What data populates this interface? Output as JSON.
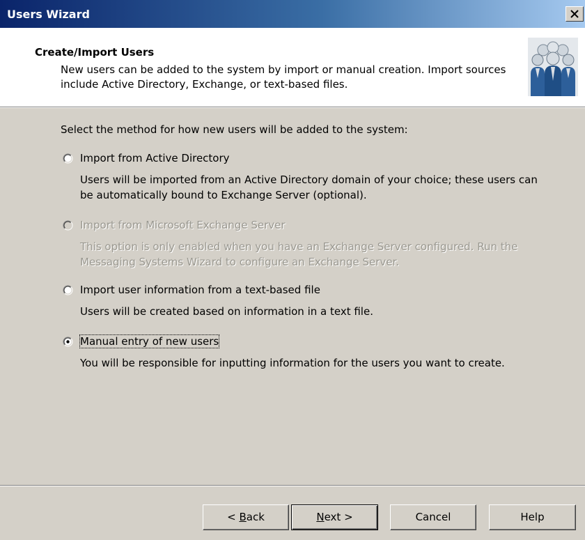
{
  "window": {
    "title": "Users Wizard"
  },
  "header": {
    "title": "Create/Import Users",
    "description": "New users can be added to the system by import or manual creation.  Import sources include Active Directory, Exchange, or text-based files.",
    "icon": "users-group-icon"
  },
  "body": {
    "prompt": "Select the method for how new users will be added to the system:",
    "options": [
      {
        "label": "Import from Active Directory",
        "description": "Users will be imported from an Active Directory domain of your choice; these users can be automatically bound to Exchange Server (optional).",
        "enabled": true,
        "selected": false
      },
      {
        "label": "Import from Microsoft Exchange Server",
        "description": "This option is only enabled when you have an Exchange Server configured.  Run the Messaging Systems Wizard to configure an Exchange Server.",
        "enabled": false,
        "selected": false
      },
      {
        "label": "Import user information from a text-based file",
        "description": "Users will be created based on information in a text file.",
        "enabled": true,
        "selected": false
      },
      {
        "label": "Manual entry of new users",
        "description": "You will be responsible for inputting information for the users you want to create.",
        "enabled": true,
        "selected": true
      }
    ]
  },
  "footer": {
    "back_label_pre": "< ",
    "back_label_key": "B",
    "back_label_post": "ack",
    "next_label_key": "N",
    "next_label_post": "ext >",
    "cancel_label": "Cancel",
    "help_label": "Help"
  },
  "colors": {
    "title_bar_start": "#0a246a",
    "title_bar_end": "#a6caf0",
    "dialog_face": "#d4d0c8",
    "disabled_text": "#9a9890"
  }
}
